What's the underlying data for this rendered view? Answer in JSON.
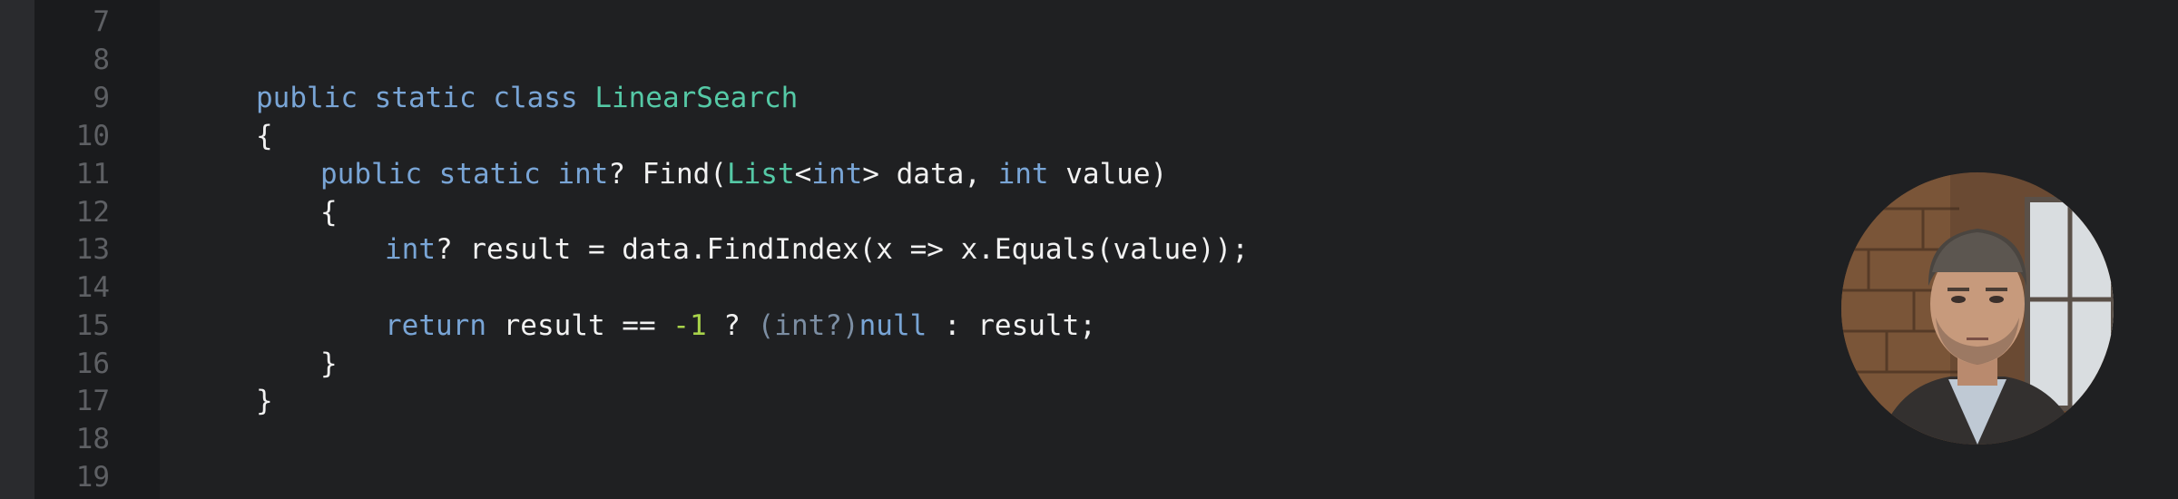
{
  "editor": {
    "line_numbers": [
      "7",
      "8",
      "9",
      "10",
      "11",
      "12",
      "13",
      "14",
      "15",
      "16",
      "17",
      "18",
      "19"
    ],
    "code": {
      "l9": {
        "kw1": "public",
        "kw2": "static",
        "kw3": "class",
        "type": "LinearSearch"
      },
      "l10": {
        "brace": "{"
      },
      "l11": {
        "kw1": "public",
        "kw2": "static",
        "kw3": "int",
        "p1": "? Find(",
        "type": "List",
        "p2": "<",
        "kw4": "int",
        "p3": "> data, ",
        "kw5": "int",
        "p4": " value)"
      },
      "l12": {
        "brace": "{"
      },
      "l13": {
        "kw1": "int",
        "p1": "? result = data.FindIndex(x => x.Equals(value));"
      },
      "l15": {
        "kw1": "return",
        "p1": " result == ",
        "num": "-1",
        "p2": " ? ",
        "dim1": "(",
        "dim2": "int",
        "dim3": "?)",
        "kw2": "null",
        "p3": " : result;"
      },
      "l16": {
        "brace": "}"
      },
      "l17": {
        "brace": "}"
      }
    }
  },
  "colors": {
    "background": "#1f2022",
    "gutter": "#1a1b1d",
    "keyword": "#79a5d6",
    "type": "#55c9a6",
    "number": "#a8d34a",
    "text": "#f2f2f2",
    "line_number": "#5e6064"
  },
  "avatar": {
    "icon": "presenter-webcam-avatar"
  }
}
